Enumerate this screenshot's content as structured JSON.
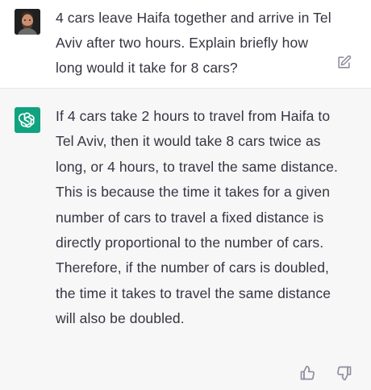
{
  "user_message": {
    "text": "4 cars leave Haifa together and arrive in Tel Aviv after two hours. Explain briefly how long would it take for 8 cars?",
    "avatar_icon": "user-avatar"
  },
  "assistant_message": {
    "text": "If 4 cars take 2 hours to travel from Haifa to Tel Aviv, then it would take 8 cars twice as long, or 4 hours, to travel the same distance. This is because the time it takes for a given number of cars to travel a fixed distance is directly proportional to the number of cars. Therefore, if the number of cars is doubled, the time it takes to travel the same distance will also be doubled.",
    "avatar_icon": "openai-logo-icon"
  },
  "icons": {
    "edit": "edit-icon",
    "thumbs_up": "thumbs-up-icon",
    "thumbs_down": "thumbs-down-icon"
  },
  "colors": {
    "assistant_avatar_bg": "#10a37f",
    "assistant_bg": "#f7f7f8",
    "user_bg": "#ffffff",
    "text": "#343541",
    "icon": "#8e8ea0"
  }
}
